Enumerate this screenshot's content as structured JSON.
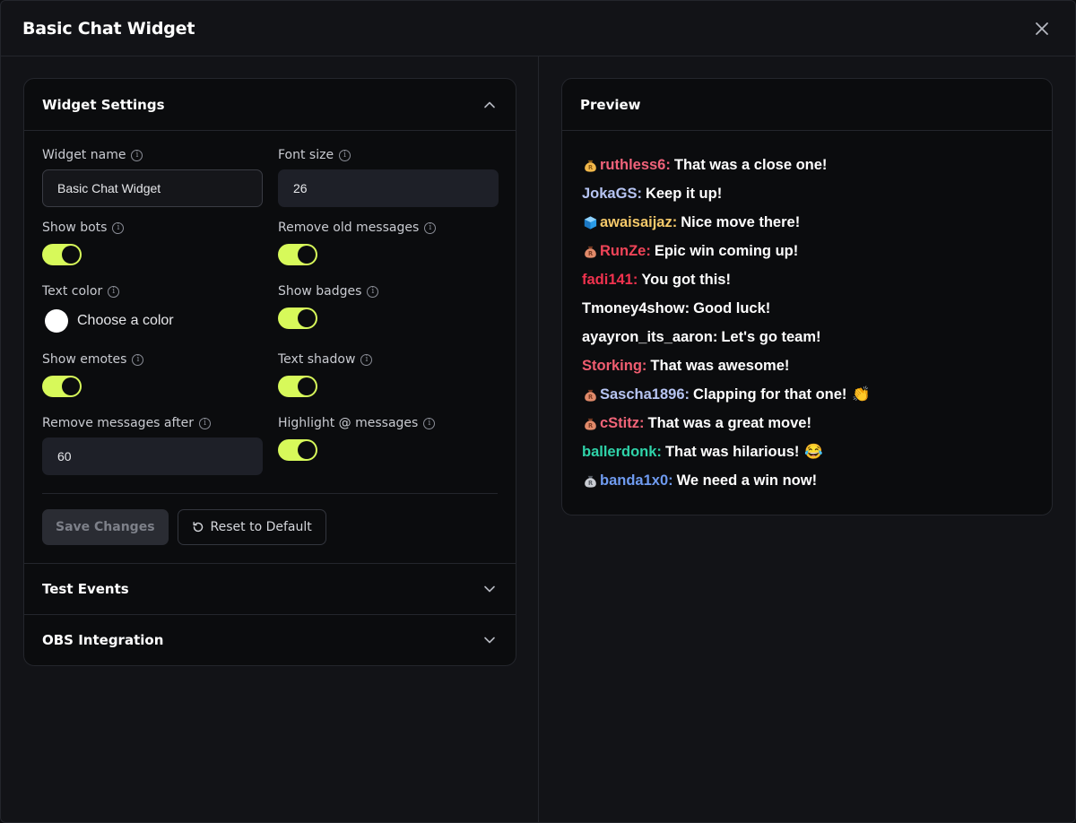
{
  "modal": {
    "title": "Basic Chat Widget"
  },
  "settings": {
    "title": "Widget Settings",
    "widget_name": {
      "label": "Widget name",
      "value": "Basic Chat Widget"
    },
    "font_size": {
      "label": "Font size",
      "value": "26"
    },
    "show_bots": {
      "label": "Show bots",
      "on": true
    },
    "remove_old": {
      "label": "Remove old messages",
      "on": true
    },
    "text_color": {
      "label": "Text color",
      "placeholder": "Choose a color",
      "color": "#ffffff"
    },
    "show_badges": {
      "label": "Show badges",
      "on": true
    },
    "show_emotes": {
      "label": "Show emotes",
      "on": true
    },
    "text_shadow": {
      "label": "Text shadow",
      "on": true
    },
    "remove_after": {
      "label": "Remove messages after",
      "value": "60"
    },
    "highlight": {
      "label": "Highlight @ messages",
      "on": true
    },
    "save_label": "Save Changes",
    "reset_label": "Reset to Default"
  },
  "sections": {
    "test_events": "Test Events",
    "obs": "OBS Integration"
  },
  "preview": {
    "title": "Preview",
    "messages": [
      {
        "badge": "money-bag-gold",
        "user": "ruthless6:",
        "color": "#f0627a",
        "text": "That was a close one!",
        "emoji": ""
      },
      {
        "badge": "",
        "user": "JokaGS:",
        "color": "#b6c4f2",
        "text": "Keep it up!",
        "emoji": ""
      },
      {
        "badge": "ice-cube",
        "user": "awaisaijaz:",
        "color": "#f5c96a",
        "text": "Nice move there!",
        "emoji": ""
      },
      {
        "badge": "money-bag-red",
        "user": "RunZe:",
        "color": "#f04458",
        "text": "Epic win coming up!",
        "emoji": ""
      },
      {
        "badge": "",
        "user": "fadi141:",
        "color": "#f0324e",
        "text": "You got this!",
        "emoji": ""
      },
      {
        "badge": "",
        "user": "Tmoney4show:",
        "color": "#ffffff",
        "text": "Good luck!",
        "emoji": ""
      },
      {
        "badge": "",
        "user": "ayayron_its_aaron:",
        "color": "#ffffff",
        "text": "Let's go team!",
        "emoji": ""
      },
      {
        "badge": "",
        "user": "Storking:",
        "color": "#f05d70",
        "text": "That was awesome!",
        "emoji": ""
      },
      {
        "badge": "money-bag-red",
        "user": "Sascha1896:",
        "color": "#b6c4f2",
        "text": "Clapping for that one!",
        "emoji": "👏"
      },
      {
        "badge": "money-bag-red",
        "user": "cStitz:",
        "color": "#f06478",
        "text": "That was a great move!",
        "emoji": ""
      },
      {
        "badge": "",
        "user": "ballerdonk:",
        "color": "#2fd3a9",
        "text": "That was hilarious!",
        "emoji": "😂"
      },
      {
        "badge": "money-bag-gray",
        "user": "banda1x0:",
        "color": "#6f9bf0",
        "text": "We need a win now!",
        "emoji": ""
      }
    ]
  },
  "colors": {
    "accent": "#d7f95a",
    "background": "#121317",
    "card": "#0b0c0e"
  }
}
